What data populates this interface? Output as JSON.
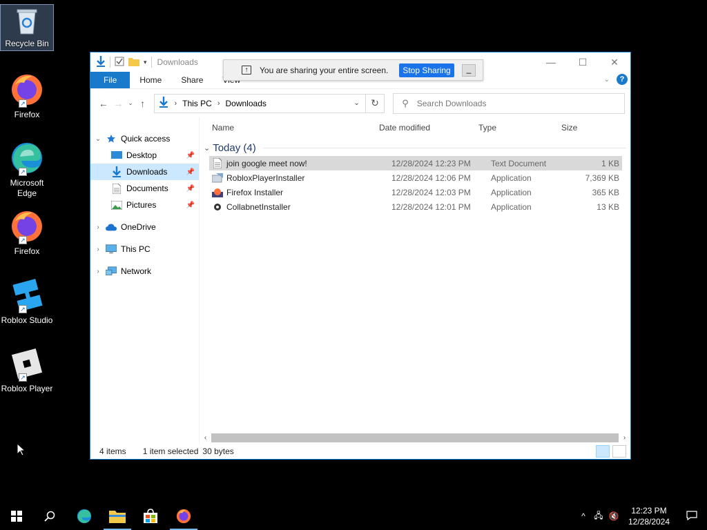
{
  "desktop": {
    "icons": [
      {
        "label": "Recycle Bin"
      },
      {
        "label": "Firefox"
      },
      {
        "label": "Microsoft Edge"
      },
      {
        "label": "Firefox"
      },
      {
        "label": "Roblox Studio"
      },
      {
        "label": "Roblox Player"
      }
    ]
  },
  "window": {
    "title": "Downloads",
    "ribbon_tabs": {
      "file": "File",
      "home": "Home",
      "share": "Share",
      "view": "View"
    },
    "address": {
      "root": "This PC",
      "current": "Downloads"
    },
    "search": {
      "placeholder": "Search Downloads"
    },
    "nav": {
      "quick_access": "Quick access",
      "desktop": "Desktop",
      "downloads": "Downloads",
      "documents": "Documents",
      "pictures": "Pictures",
      "onedrive": "OneDrive",
      "this_pc": "This PC",
      "network": "Network"
    },
    "columns": {
      "name": "Name",
      "date": "Date modified",
      "type": "Type",
      "size": "Size"
    },
    "group": "Today (4)",
    "files": [
      {
        "name": "join google meet now!",
        "date": "12/28/2024 12:23 PM",
        "type": "Text Document",
        "size": "1 KB"
      },
      {
        "name": "RobloxPlayerInstaller",
        "date": "12/28/2024 12:06 PM",
        "type": "Application",
        "size": "7,369 KB"
      },
      {
        "name": "Firefox Installer",
        "date": "12/28/2024 12:03 PM",
        "type": "Application",
        "size": "365 KB"
      },
      {
        "name": "CollabnetInstaller",
        "date": "12/28/2024 12:01 PM",
        "type": "Application",
        "size": "13 KB"
      }
    ],
    "status": {
      "count": "4 items",
      "selected": "1 item selected",
      "bytes": "30 bytes"
    }
  },
  "share_bar": {
    "message": "You are sharing your entire screen.",
    "stop": "Stop Sharing",
    "minimize": "_"
  },
  "taskbar": {
    "time": "12:23 PM",
    "date": "12/28/2024"
  },
  "colors": {
    "accent": "#1979ca",
    "selection": "#cce8ff",
    "meet_blue": "#1a73e8"
  }
}
